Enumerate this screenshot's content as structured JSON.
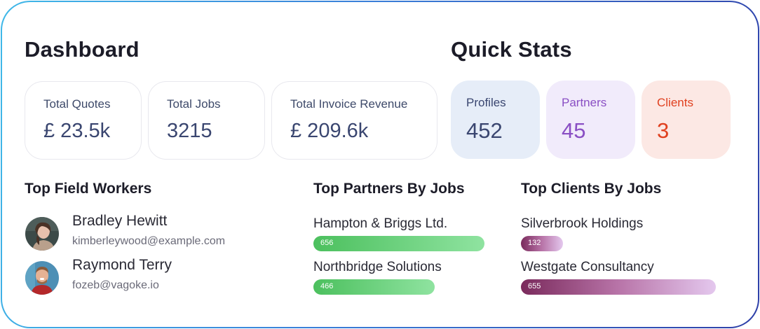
{
  "dashboard": {
    "title": "Dashboard",
    "stats": [
      {
        "label": "Total Quotes",
        "value": "£ 23.5k"
      },
      {
        "label": "Total Jobs",
        "value": "3215"
      },
      {
        "label": "Total Invoice Revenue",
        "value": "£ 209.6k"
      }
    ]
  },
  "quick_stats": {
    "title": "Quick Stats",
    "cards": [
      {
        "label": "Profiles",
        "value": "452",
        "color": "#3a4670",
        "bg": "#e6edf8"
      },
      {
        "label": "Partners",
        "value": "45",
        "color": "#8a4fc4",
        "bg": "#f1ebfb"
      },
      {
        "label": "Clients",
        "value": "3",
        "color": "#e0401f",
        "bg": "#fce8e4"
      }
    ]
  },
  "top_field_workers": {
    "title": "Top Field Workers",
    "workers": [
      {
        "name": "Bradley Hewitt",
        "email": "kimberleywood@example.com",
        "avatar_icon": "person-photo-icon"
      },
      {
        "name": "Raymond Terry",
        "email": "fozeb@vagoke.io",
        "avatar_icon": "person-photo-icon"
      }
    ]
  },
  "top_partners": {
    "title": "Top Partners By Jobs",
    "items": [
      {
        "name": "Hampton & Briggs Ltd.",
        "jobs": "656",
        "fraction": 1.0
      },
      {
        "name": "Northbridge Solutions",
        "jobs": "466",
        "fraction": 0.71
      }
    ],
    "bar_color": "#4cc05e"
  },
  "top_clients": {
    "title": "Top Clients By Jobs",
    "items": [
      {
        "name": "Silverbrook Holdings",
        "jobs": "132",
        "fraction": 0.2
      },
      {
        "name": "Westgate Consultancy",
        "jobs": "655",
        "fraction": 1.0
      }
    ],
    "bar_color": "#7a2a5c"
  }
}
